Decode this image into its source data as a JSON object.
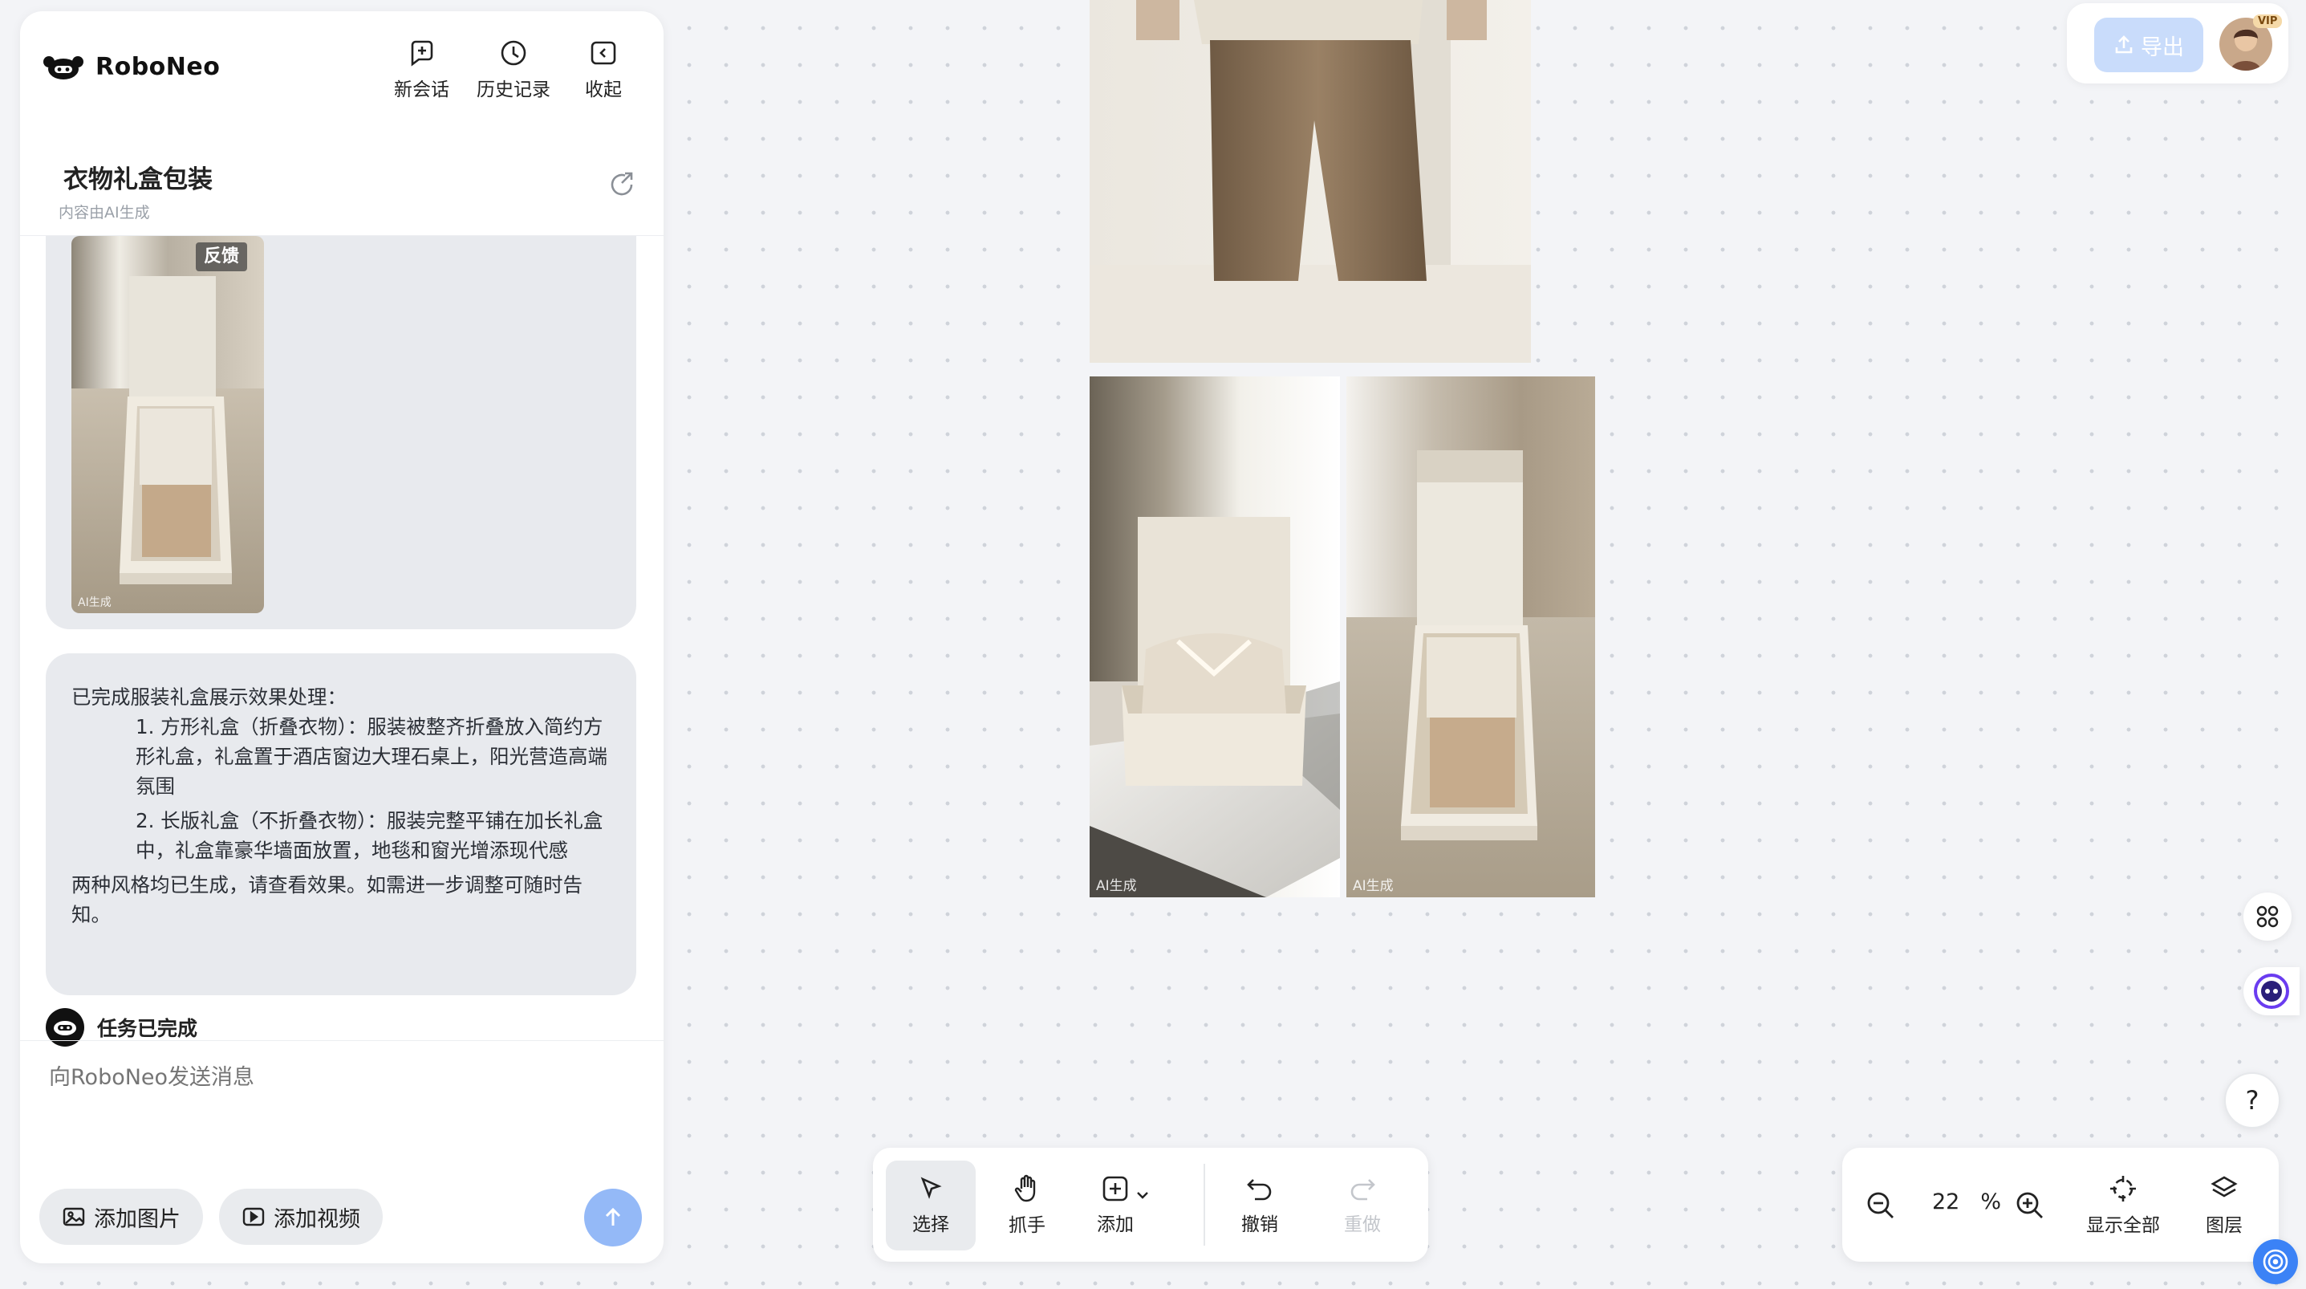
{
  "brand": {
    "name": "RoboNeo"
  },
  "header": {
    "new_chat": "新会话",
    "history": "历史记录",
    "collapse": "收起"
  },
  "conversation": {
    "title": "衣物礼盒包装",
    "subtitle": "内容由AI生成"
  },
  "messages": {
    "feedback": "反馈",
    "thumb_tag": "AI生成",
    "reply": {
      "intro": "已完成服装礼盒展示效果处理：",
      "item1": "1. 方形礼盒（折叠衣物）：服装被整齐折叠放入简约方形礼盒，礼盒置于酒店窗边大理石桌上，阳光营造高端氛围",
      "item2": "2. 长版礼盒（不折叠衣物）：服装完整平铺在加长礼盒中，礼盒靠豪华墙面放置，地毯和窗光增添现代感",
      "outro": "两种风格均已生成，请查看效果。如需进一步调整可随时告知。"
    },
    "status": "任务已完成"
  },
  "input": {
    "placeholder": "向RoboNeo发送消息",
    "add_image": "添加图片",
    "add_video": "添加视频"
  },
  "canvas": {
    "ai_tag_1": "AI生成",
    "ai_tag_2": "AI生成"
  },
  "topbar": {
    "export": "导出",
    "vip": "VIP"
  },
  "toolbar": {
    "select": "选择",
    "hand": "抓手",
    "add": "添加",
    "undo": "撤销",
    "redo": "重做"
  },
  "zoom": {
    "value": "22",
    "unit": "%",
    "fit_all": "显示全部",
    "layers": "图层"
  },
  "side": {
    "help": "?"
  }
}
